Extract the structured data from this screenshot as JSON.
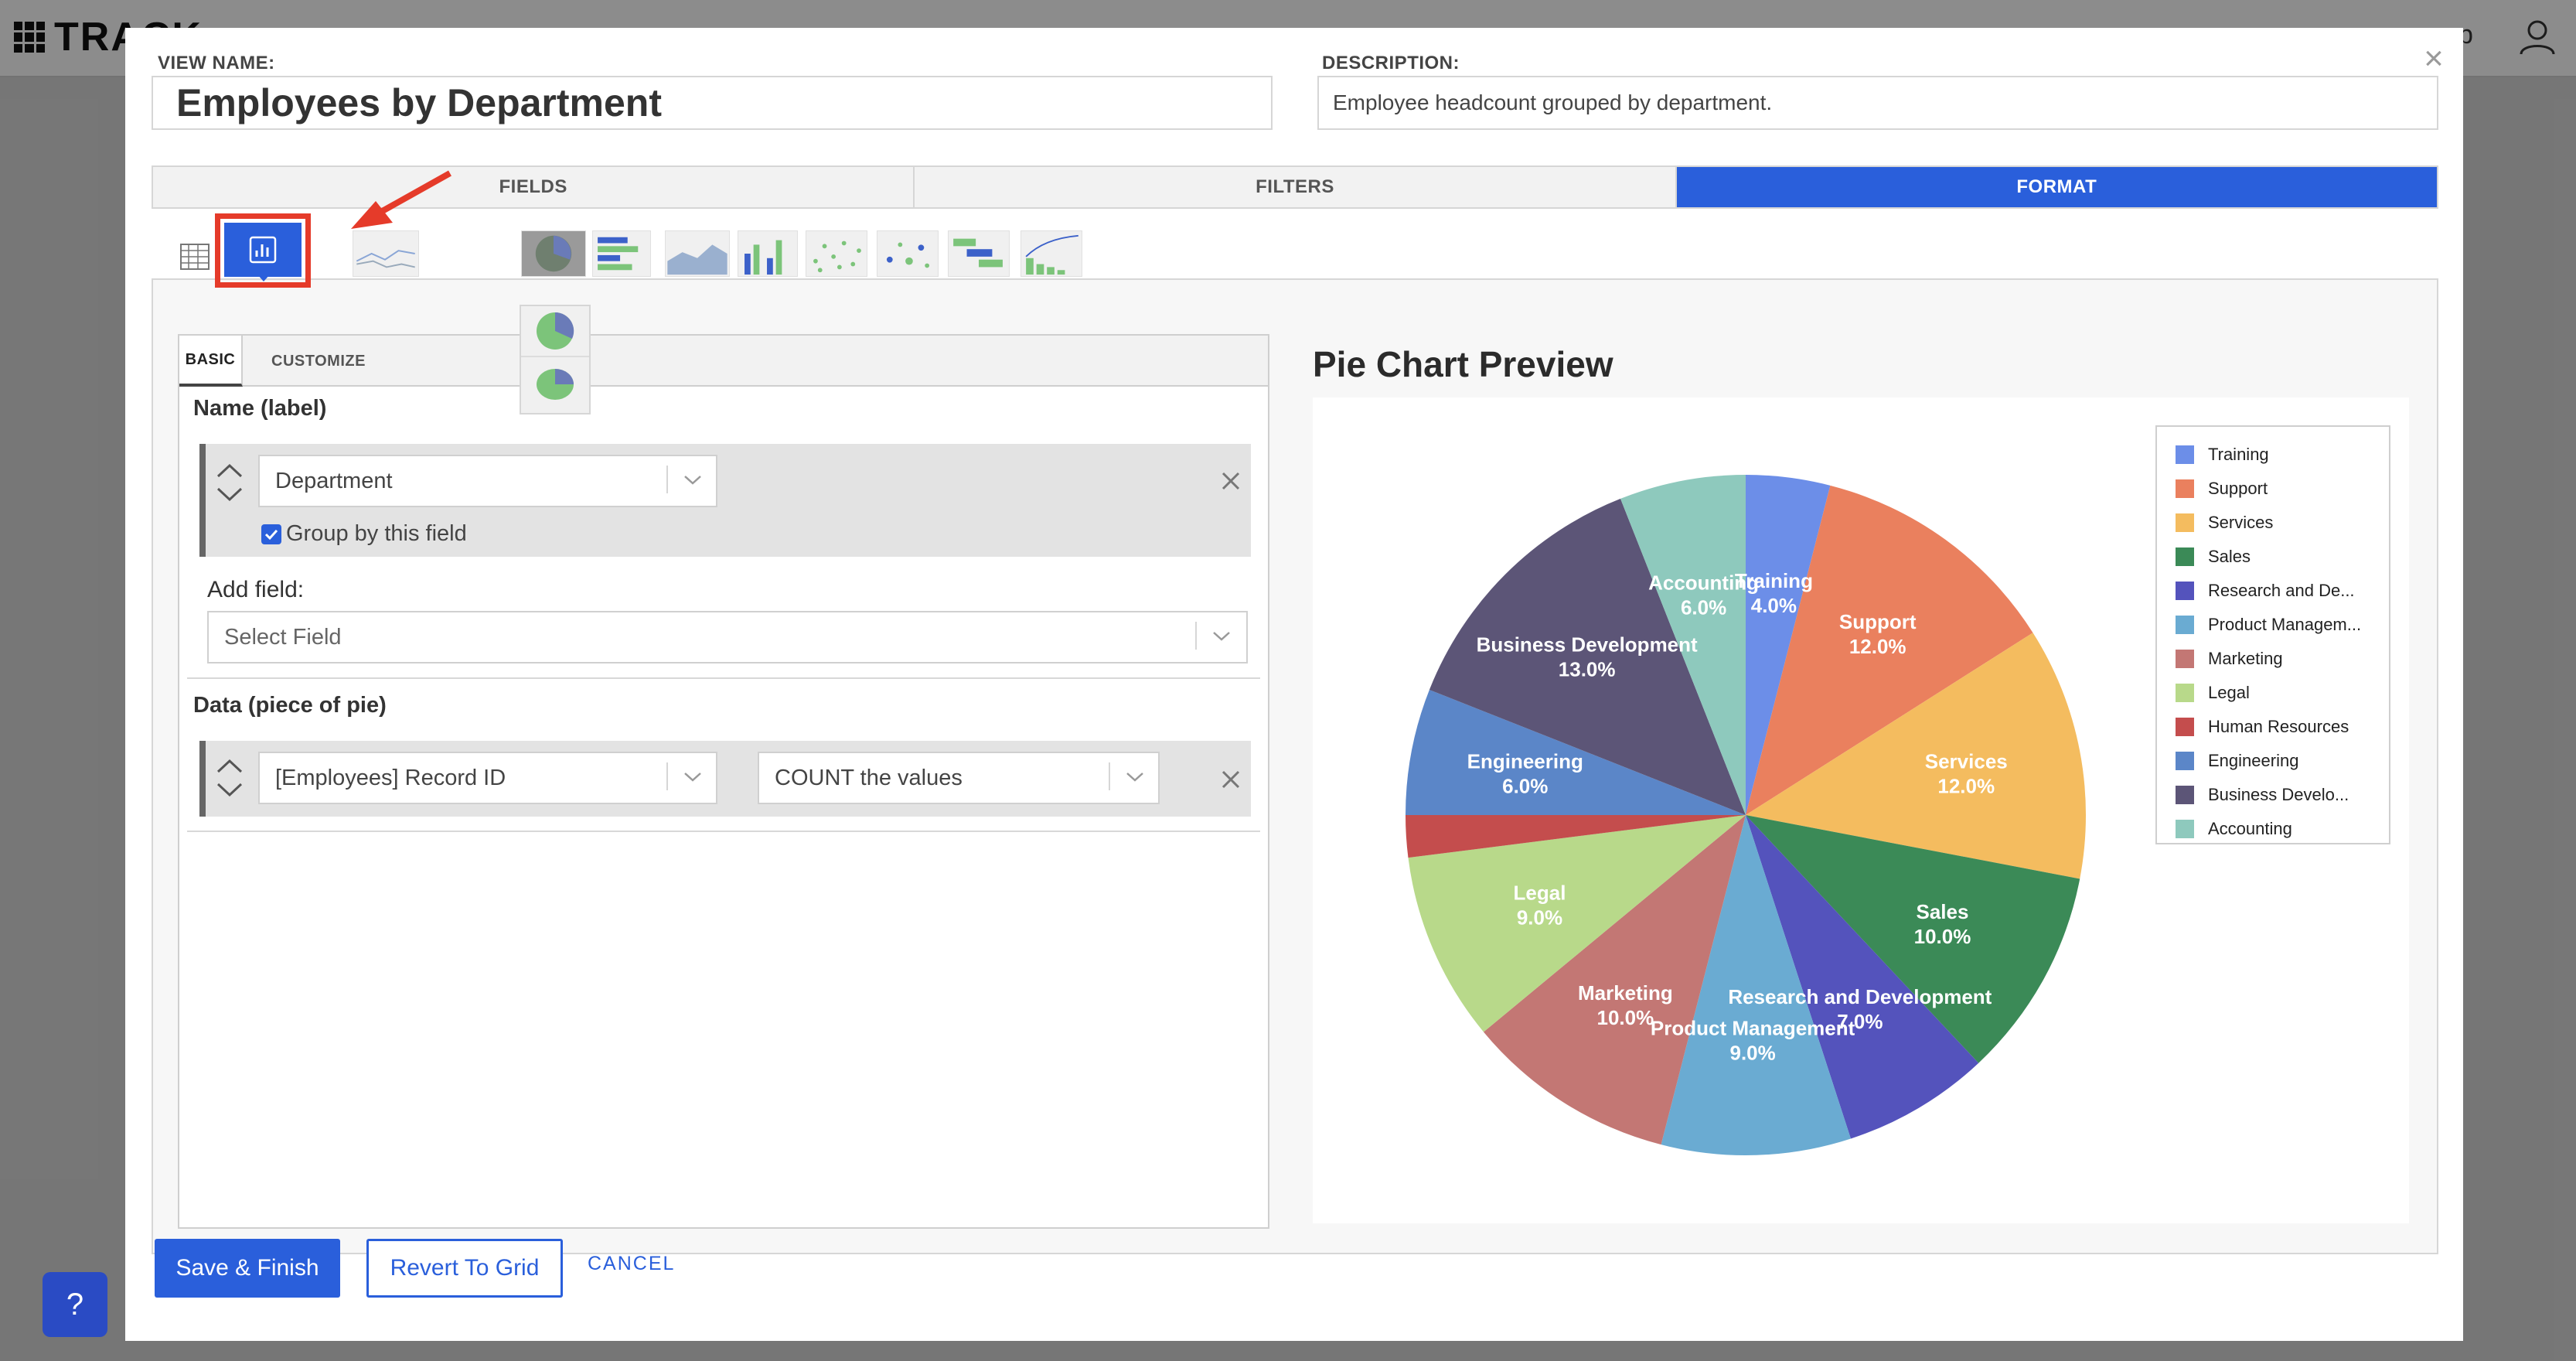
{
  "background": {
    "logo_text": "TRACK",
    "right_text": "p"
  },
  "modal": {
    "view_name_label": "VIEW NAME:",
    "view_name_value": "Employees by Department",
    "description_label": "DESCRIPTION:",
    "description_value": "Employee headcount grouped by department.",
    "close_icon": "close-icon"
  },
  "tabs": [
    {
      "label": "FIELDS",
      "active": false
    },
    {
      "label": "FILTERS",
      "active": false
    },
    {
      "label": "FORMAT",
      "active": true
    }
  ],
  "chart_types": {
    "icons": [
      "table-icon",
      "pie-bar-icon",
      "line-icon",
      "pie-icon",
      "horizontal-bar-icon",
      "area-icon",
      "bar-icon",
      "scatter-icon",
      "bubble-icon",
      "gantt-icon",
      "pareto-icon"
    ],
    "selected": "pie-bar-icon",
    "dropdown_options": [
      "pie-icon",
      "donut-3d-icon"
    ]
  },
  "left": {
    "subtabs": {
      "basic": "BASIC",
      "customize": "CUSTOMIZE"
    },
    "name_section_title": "Name (label)",
    "label_field_value": "Department",
    "group_by_label": "Group by this field",
    "group_by_checked": true,
    "add_field_label": "Add field:",
    "add_field_placeholder": "Select Field",
    "data_section_title": "Data (piece of pie)",
    "data_field_value": "[Employees] Record ID",
    "aggregate_value": "COUNT the values"
  },
  "preview": {
    "title": "Pie Chart Preview"
  },
  "colors": {
    "accent": "#2a5fdb",
    "highlight_frame": "#e53b2a"
  },
  "footer": {
    "save_label": "Save & Finish",
    "revert_label": "Revert To Grid",
    "cancel_label": "CANCEL"
  },
  "help": {
    "label": "?"
  },
  "chart_data": {
    "type": "pie",
    "title": "",
    "slices": [
      {
        "label": "Training",
        "value": 4.0,
        "display": "4.0%",
        "color": "#6c8ee8",
        "legend": "Training"
      },
      {
        "label": "Support",
        "value": 12.0,
        "display": "12.0%",
        "color": "#ea805e",
        "legend": "Support"
      },
      {
        "label": "Services",
        "value": 12.0,
        "display": "12.0%",
        "color": "#f4bc5f",
        "legend": "Services"
      },
      {
        "label": "Sales",
        "value": 10.0,
        "display": "10.0%",
        "color": "#3b8a57",
        "legend": "Sales"
      },
      {
        "label": "Research and Development",
        "value": 7.0,
        "display": "7.0%",
        "color": "#5453bc",
        "legend": "Research and De..."
      },
      {
        "label": "Product Management",
        "value": 9.0,
        "display": "9.0%",
        "color": "#6aabd2",
        "legend": "Product Managem..."
      },
      {
        "label": "Marketing",
        "value": 10.0,
        "display": "10.0%",
        "color": "#c37774",
        "legend": "Marketing"
      },
      {
        "label": "Legal",
        "value": 9.0,
        "display": "9.0%",
        "color": "#b8d98a",
        "legend": "Legal"
      },
      {
        "label": "Human Resources",
        "value": 2.0,
        "display": "",
        "color": "#c44d4d",
        "legend": "Human Resources"
      },
      {
        "label": "Engineering",
        "value": 6.0,
        "display": "6.0%",
        "color": "#5b86c8",
        "legend": "Engineering"
      },
      {
        "label": "Business Development",
        "value": 13.0,
        "display": "13.0%",
        "color": "#5c5577",
        "legend": "Business Develo..."
      },
      {
        "label": "Accounting",
        "value": 6.0,
        "display": "6.0%",
        "color": "#8ec9bd",
        "legend": "Accounting"
      }
    ],
    "legend_position": "right"
  }
}
